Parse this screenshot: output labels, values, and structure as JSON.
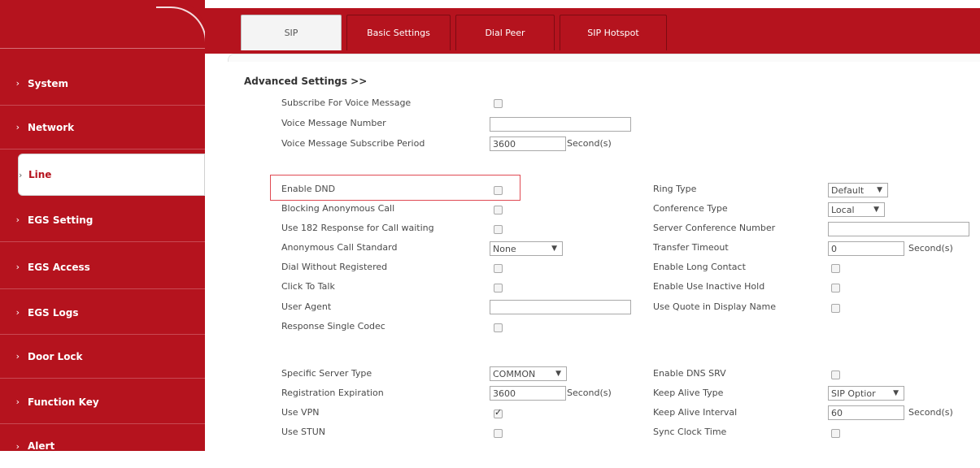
{
  "sidebar": {
    "items": [
      {
        "label": "System"
      },
      {
        "label": "Network"
      },
      {
        "label": "Line"
      },
      {
        "label": "EGS Setting"
      },
      {
        "label": "EGS Access"
      },
      {
        "label": "EGS Logs"
      },
      {
        "label": "Door Lock"
      },
      {
        "label": "Function Key"
      },
      {
        "label": "Alert"
      }
    ],
    "active": "Line",
    "chevron": "›"
  },
  "tabs": [
    {
      "label": "SIP",
      "active": true
    },
    {
      "label": "Basic Settings"
    },
    {
      "label": "Dial Peer"
    },
    {
      "label": "SIP Hotspot"
    }
  ],
  "section_title": "Advanced Settings >>",
  "left_fields": [
    {
      "label": "Subscribe For Voice Message",
      "type": "checkbox",
      "checked": false
    },
    {
      "label": "Voice Message Number",
      "type": "text",
      "value": ""
    },
    {
      "label": "Voice Message Subscribe Period",
      "type": "text",
      "value": "3600",
      "unit": "Second(s)"
    },
    {
      "label": "Enable DND",
      "type": "checkbox",
      "checked": false
    },
    {
      "label": "Blocking Anonymous Call",
      "type": "checkbox",
      "checked": false
    },
    {
      "label": "Use 182 Response for Call waiting",
      "type": "checkbox",
      "checked": false
    },
    {
      "label": "Anonymous Call Standard",
      "type": "select",
      "value": "None"
    },
    {
      "label": "Dial Without Registered",
      "type": "checkbox",
      "checked": false
    },
    {
      "label": "Click To Talk",
      "type": "checkbox",
      "checked": false
    },
    {
      "label": "User Agent",
      "type": "text",
      "value": ""
    },
    {
      "label": "Response Single Codec",
      "type": "checkbox",
      "checked": false
    },
    {
      "label": "Specific Server Type",
      "type": "select",
      "value": "COMMON"
    },
    {
      "label": "Registration Expiration",
      "type": "text",
      "value": "3600",
      "unit": "Second(s)"
    },
    {
      "label": "Use VPN",
      "type": "checkbox",
      "checked": true
    },
    {
      "label": "Use STUN",
      "type": "checkbox",
      "checked": false
    }
  ],
  "right_fields": [
    {
      "label": "Ring Type",
      "type": "select",
      "value": "Default"
    },
    {
      "label": "Conference Type",
      "type": "select",
      "value": "Local"
    },
    {
      "label": "Server Conference Number",
      "type": "text",
      "value": ""
    },
    {
      "label": "Transfer Timeout",
      "type": "text",
      "value": "0",
      "unit": "Second(s)"
    },
    {
      "label": "Enable Long Contact",
      "type": "checkbox",
      "checked": false
    },
    {
      "label": "Enable Use Inactive Hold",
      "type": "checkbox",
      "checked": false
    },
    {
      "label": "Use Quote in Display Name",
      "type": "checkbox",
      "checked": false
    },
    {
      "label": "Enable DNS SRV",
      "type": "checkbox",
      "checked": false
    },
    {
      "label": "Keep Alive Type",
      "type": "select",
      "value": "SIP Optior"
    },
    {
      "label": "Keep Alive Interval",
      "type": "text",
      "value": "60",
      "unit": "Second(s)"
    },
    {
      "label": "Sync Clock Time",
      "type": "checkbox",
      "checked": false
    }
  ],
  "colors": {
    "brand": "#b5131e",
    "highlight": "#e04a53"
  },
  "select_arrow": "▼"
}
